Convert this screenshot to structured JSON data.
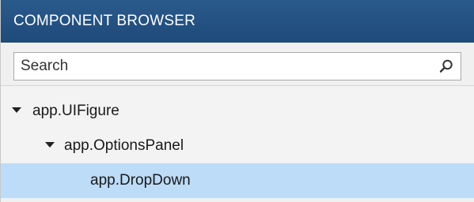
{
  "header": {
    "title": "COMPONENT BROWSER"
  },
  "search": {
    "placeholder": "Search",
    "value": "",
    "icon": "search-icon"
  },
  "tree": {
    "items": [
      {
        "label": "app.UIFigure",
        "level": 0,
        "expanded": true,
        "selected": false,
        "icon": "caret-down-icon"
      },
      {
        "label": "app.OptionsPanel",
        "level": 1,
        "expanded": true,
        "selected": false,
        "icon": "caret-down-icon"
      },
      {
        "label": "app.DropDown",
        "level": 2,
        "expanded": null,
        "selected": true
      }
    ]
  },
  "colors": {
    "header_bg": "#1e4a79",
    "header_text": "#ffffff",
    "selected_row": "#bcdcf7",
    "panel_bg": "#f0f0f0"
  }
}
